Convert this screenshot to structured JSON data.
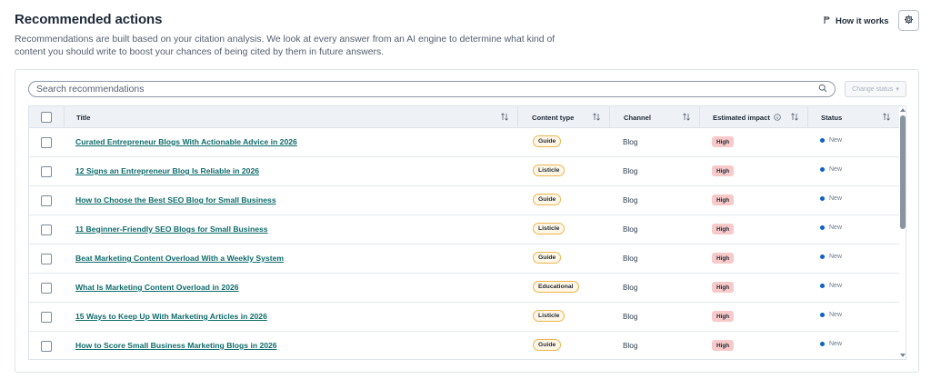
{
  "header": {
    "title": "Recommended actions",
    "description": "Recommendations are built based on your citation analysis. We look at every answer from an AI engine to determine what kind of content you should write to boost your chances of being cited by them in future answers.",
    "how_it_works_label": "How it works",
    "settings_icon": "gear-icon"
  },
  "toolbar": {
    "search_placeholder": "Search recommendations",
    "change_status_label": "Change status"
  },
  "table": {
    "columns": {
      "title": "Title",
      "content_type": "Content type",
      "channel": "Channel",
      "impact": "Estimated impact",
      "status": "Status"
    },
    "rows": [
      {
        "title": "Curated Entrepreneur Blogs With Actionable Advice in 2026",
        "content_type": "Guide",
        "channel": "Blog",
        "impact": "High",
        "status": "New"
      },
      {
        "title": "12 Signs an Entrepreneur Blog Is Reliable in 2026",
        "content_type": "Listicle",
        "channel": "Blog",
        "impact": "High",
        "status": "New"
      },
      {
        "title": "How to Choose the Best SEO Blog for Small Business",
        "content_type": "Guide",
        "channel": "Blog",
        "impact": "High",
        "status": "New"
      },
      {
        "title": "11 Beginner-Friendly SEO Blogs for Small Business",
        "content_type": "Listicle",
        "channel": "Blog",
        "impact": "High",
        "status": "New"
      },
      {
        "title": "Beat Marketing Content Overload With a Weekly System",
        "content_type": "Guide",
        "channel": "Blog",
        "impact": "High",
        "status": "New"
      },
      {
        "title": "What Is Marketing Content Overload in 2026",
        "content_type": "Educational",
        "channel": "Blog",
        "impact": "High",
        "status": "New"
      },
      {
        "title": "15 Ways to Keep Up With Marketing Articles in 2026",
        "content_type": "Listicle",
        "channel": "Blog",
        "impact": "High",
        "status": "New"
      },
      {
        "title": "How to Score Small Business Marketing Blogs in 2026",
        "content_type": "Guide",
        "channel": "Blog",
        "impact": "High",
        "status": "New"
      }
    ]
  },
  "colors": {
    "link": "#0f6b6b",
    "tag_border": "#e9b650",
    "impact_high_bg": "#f7c9c9",
    "status_new_dot": "#0b63c4"
  }
}
